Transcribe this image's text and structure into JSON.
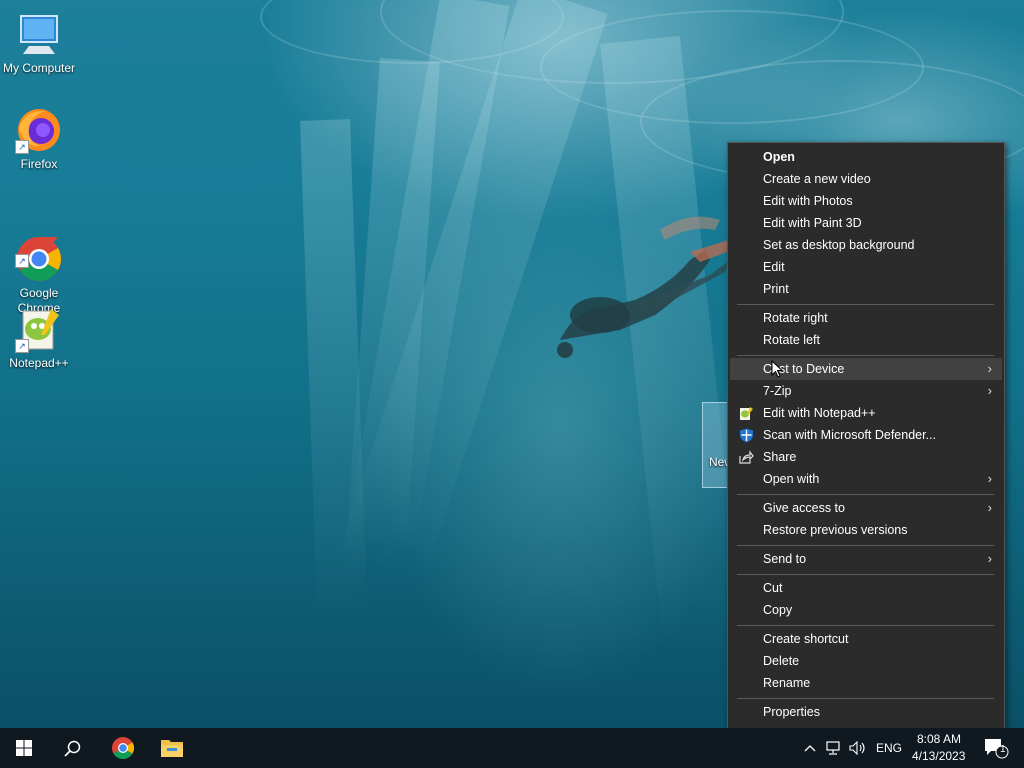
{
  "desktop": {
    "icons": [
      {
        "label": "My Computer",
        "icon": "monitor-icon"
      },
      {
        "label": "Firefox",
        "icon": "firefox-icon"
      },
      {
        "label": "Google\nChrome",
        "icon": "chrome-icon"
      },
      {
        "label": "Notepad++",
        "icon": "notepad-plus-plus-icon"
      }
    ],
    "selected_file_label": "New"
  },
  "context_menu": {
    "items": [
      {
        "label": "Open",
        "bold": true
      },
      {
        "label": "Create a new video"
      },
      {
        "label": "Edit with Photos"
      },
      {
        "label": "Edit with Paint 3D"
      },
      {
        "label": "Set as desktop background"
      },
      {
        "label": "Edit"
      },
      {
        "label": "Print"
      },
      {
        "label": "Rotate right"
      },
      {
        "label": "Rotate left"
      },
      {
        "label": "Cast to Device",
        "submenu": true,
        "hover": true
      },
      {
        "label": "7-Zip",
        "submenu": true
      },
      {
        "label": "Edit with Notepad++",
        "icon": "notepad-plus-plus-icon"
      },
      {
        "label": "Scan with Microsoft Defender...",
        "icon": "defender-shield-icon"
      },
      {
        "label": "Share",
        "icon": "share-icon"
      },
      {
        "label": "Open with",
        "submenu": true
      },
      {
        "label": "Give access to",
        "submenu": true
      },
      {
        "label": "Restore previous versions"
      },
      {
        "label": "Send to",
        "submenu": true
      },
      {
        "label": "Cut"
      },
      {
        "label": "Copy"
      },
      {
        "label": "Create shortcut"
      },
      {
        "label": "Delete"
      },
      {
        "label": "Rename"
      },
      {
        "label": "Properties"
      }
    ],
    "submenu_arrow": "›"
  },
  "taskbar": {
    "start_icon": "windows-logo-icon",
    "search_icon": "search-icon",
    "pinned": [
      "chrome-icon",
      "file-explorer-icon"
    ],
    "tray": {
      "language": "ENG",
      "time": "8:08 AM",
      "date": "4/13/2023",
      "notification_count": "1"
    }
  },
  "colors": {
    "menu_bg": "#2b2b2b",
    "menu_hover": "#414141",
    "taskbar_bg": "#101820",
    "accent": "#0078d7"
  }
}
